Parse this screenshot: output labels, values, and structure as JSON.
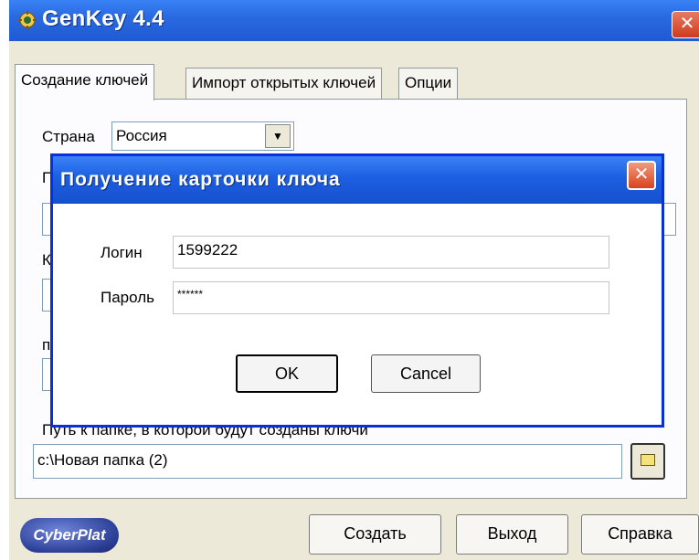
{
  "window": {
    "title": "GenKey 4.4",
    "close_glyph": "✕",
    "app_icon": "genkey-app-icon"
  },
  "tabs": [
    {
      "label": "Создание ключей",
      "active": true
    },
    {
      "label": "Импорт открытых ключей",
      "active": false
    },
    {
      "label": "Опции",
      "active": false
    }
  ],
  "form": {
    "country_label": "Страна",
    "country_value": "Россия",
    "folder_label": "Путь к папке, в которой будут созданы ключи",
    "folder_value": "c:\\Новая папка (2)",
    "hidden_label_1": "П",
    "hidden_label_2": "К",
    "hidden_label_3": "п"
  },
  "footer": {
    "logo_text": "CyberPlat",
    "create_label": "Создать",
    "exit_label": "Выход",
    "help_label": "Справка"
  },
  "dialog": {
    "title": "Получение карточки ключа",
    "close_glyph": "✕",
    "login_label": "Логин",
    "login_value": "1599222",
    "password_label": "Пароль",
    "password_value": "******",
    "ok_label": "OK",
    "cancel_label": "Cancel"
  },
  "colors": {
    "titlebar": "#2a6ae0",
    "window_bg": "#ece9d8",
    "dialog_border": "#0831d9",
    "close_button": "#d8421f"
  }
}
